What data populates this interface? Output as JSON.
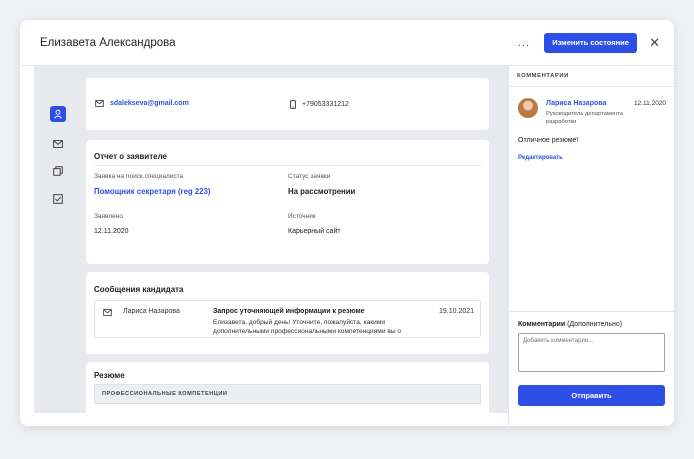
{
  "header": {
    "title": "Елизавета Александрова",
    "more_label": "...",
    "change_state_label": "Изменить состояние",
    "close_label": "✕"
  },
  "rail": {
    "icons": [
      "person-icon",
      "mail-icon",
      "copy-icon",
      "checkbox-icon"
    ],
    "active": "person-icon"
  },
  "contacts": {
    "email": "sdalekseva@gmail.com",
    "phone": "+79053331212"
  },
  "report": {
    "title": "Отчет о заявителе",
    "request_label": "Заявка на поиск специалиста",
    "request_value": "Помощник секретаря (reg 223)",
    "status_label": "Статус заявки",
    "status_value": "На рассмотрении",
    "applied_label": "Заявлено",
    "applied_value": "12.11.2020",
    "source_label": "Источник",
    "source_value": "Карьерный сайт"
  },
  "messages": {
    "title": "Сообщения кандидата",
    "items": [
      {
        "sender": "Лариса Назарова",
        "subject": "Запрос уточняющей информации к резюме",
        "body": "Елизавета, добрый день! Уточните, пожалуйста, какими дополнительными профессиональными компетенциями вы о",
        "date": "19.10.2021"
      }
    ]
  },
  "resume": {
    "title": "Резюме",
    "section": "ПРОФЕССИОНАЛЬНЫЕ КОМПЕТЕНЦИИ"
  },
  "comments": {
    "header": "КОММЕНТАРИИ",
    "items": [
      {
        "author": "Лариса Назарова",
        "role": "Руководитель департамента разработки",
        "date": "12.11.2020",
        "text": "Отличное резюме!",
        "edit_label": "Редактировать"
      }
    ],
    "form_label_bold": "Комментарии",
    "form_label_rest": " (Дополнительно)",
    "placeholder": "Добавить комментарии...",
    "send_label": "Отправить"
  },
  "colors": {
    "accent": "#2d4fe6",
    "link": "#2b51e0",
    "panel_bg": "#e8e9ec"
  }
}
